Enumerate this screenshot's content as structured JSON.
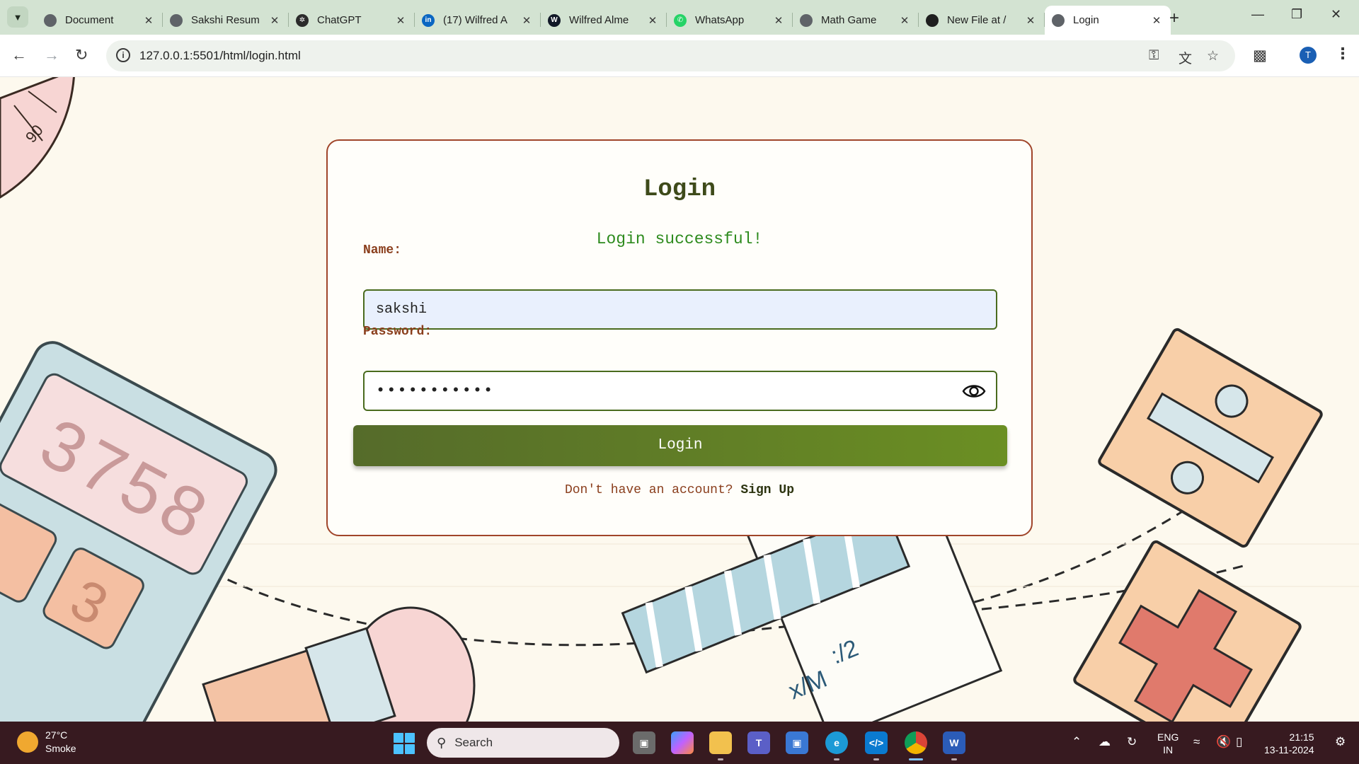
{
  "browser": {
    "tabs": [
      {
        "title": "Document",
        "favicon": "globe-icon",
        "color": "#5f6368",
        "glyph": ""
      },
      {
        "title": "Sakshi Resum",
        "favicon": "globe-icon",
        "color": "#5f6368",
        "glyph": ""
      },
      {
        "title": "ChatGPT",
        "favicon": "chatgpt-icon",
        "color": "#2b2b2b",
        "glyph": "✲"
      },
      {
        "title": "(17) Wilfred A",
        "favicon": "linkedin-icon",
        "color": "#0a66c2",
        "glyph": "in"
      },
      {
        "title": "Wilfred Alme",
        "favicon": "w-shield-icon",
        "color": "#111827",
        "glyph": "W"
      },
      {
        "title": "WhatsApp",
        "favicon": "whatsapp-icon",
        "color": "#25d366",
        "glyph": "✆"
      },
      {
        "title": "Math Game",
        "favicon": "globe-icon",
        "color": "#5f6368",
        "glyph": ""
      },
      {
        "title": "New File at /",
        "favicon": "github-icon",
        "color": "#1f1f1f",
        "glyph": ""
      },
      {
        "title": "Login",
        "favicon": "globe-icon",
        "color": "#5f6368",
        "glyph": "",
        "active": true
      }
    ],
    "url": "127.0.0.1:5501/html/login.html",
    "profile_initial": "T"
  },
  "login": {
    "title": "Login",
    "message": "Login successful!",
    "name_label": "Name:",
    "name_value": "sakshi",
    "password_label": "Password:",
    "password_value": "•••••••••••",
    "button_label": "Login",
    "signup_prompt": "Don't have an account?",
    "signup_link": "Sign Up",
    "colors": {
      "accent": "#556b2a",
      "success": "#2e8b1e",
      "border": "#a0452a",
      "label": "#8a3e1c"
    }
  },
  "background_text": {
    "calculator_display": "3758",
    "calculator_key": "3",
    "protractor_mark": "90"
  },
  "taskbar": {
    "temperature": "27°C",
    "weather": "Smoke",
    "search_placeholder": "Search",
    "language": "ENG",
    "region": "IN",
    "time": "21:15",
    "date": "13-11-2024"
  }
}
